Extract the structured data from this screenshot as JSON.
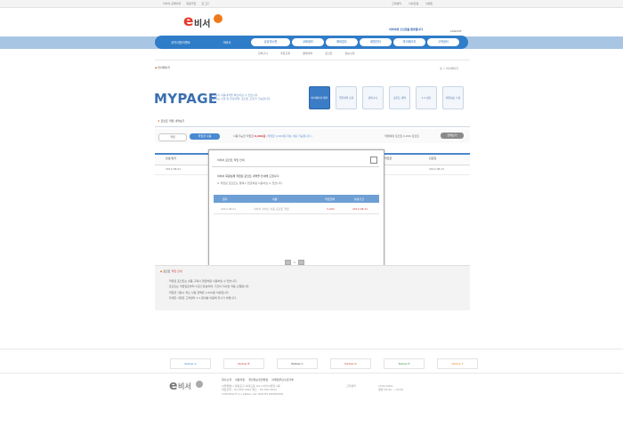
{
  "topbar": {
    "left_links": [
      "이비서 홈페이지",
      "회원가입",
      "로그인"
    ],
    "right_links": [
      "고객센터",
      "사이트맵",
      "이벤트"
    ]
  },
  "brand": {
    "logo_e": "e",
    "logo_text": "비서",
    "slogan": "이비서에 오신것을 환영합니다",
    "logout": "LOGOUT",
    "brand_color": "#2f7cc8",
    "accent_color": "#e8392b"
  },
  "nav": {
    "items": [
      "공지사항/이벤트",
      "이비서",
      "상담게시판",
      "교육정보",
      "해외업무",
      "회원관리",
      "마이페이지",
      "고객센터"
    ]
  },
  "subnav": [
    "장바구니",
    "주문조회",
    "결제내역",
    "포인트",
    "정보수정"
  ],
  "breadcrumb": {
    "left": "마이페이지",
    "right": "홈 > 마이페이지"
  },
  "mypage": {
    "title": "MYPAGE",
    "desc_line1": "고객님의 이용내역을 확인하실 수 있습니다.",
    "desc_line2": "회원정보 수정 및 주문내역, 포인트 조회가 가능합니다."
  },
  "tabs": [
    "마이페이지 메인",
    "주문내역 조회",
    "장바구니",
    "포인트 내역",
    "1:1 상담",
    "회원정보 수정"
  ],
  "section": {
    "title": "포인트 적립 내역보기"
  },
  "points": {
    "btn1": "적립",
    "btn2": "적립금 사용",
    "info_label": "사용가능한 적립금",
    "info_value": "0,000원",
    "info_note": "(적립금 1,000원 이상 사용 가능합니다.)",
    "right_label": "적립예정 포인트 0,000 포인트",
    "right_button": "전체보기"
  },
  "table": {
    "headers": [
      "번호/일자",
      "적립금",
      "만료일"
    ],
    "row": {
      "date": "2012.08.01",
      "end": "2012.08.31"
    }
  },
  "popup": {
    "title": "이비서 포인트 적립 안내",
    "text1": "이비서 회원님께 적립된 포인트 내역을 안내해 드립니다.",
    "text2": "※ 적립된 포인트는 결제시 현금처럼 사용하실 수 있습니다.",
    "headers": [
      "일자",
      "내용",
      "적립금액",
      "유효기간"
    ],
    "row": {
      "date": "2012.08.01",
      "content": "이비서 서비스 이용 포인트 적립",
      "amount": "3,000",
      "valid": "2012.08.31"
    },
    "page_num": "1"
  },
  "notice": {
    "title_prefix": "포인트",
    "title_red": "적립 안내",
    "lines": [
      "· 적립된 포인트는 상품 구매시 현금처럼 사용하실 수 있습니다.",
      "· 포인트는 적립일로부터 1년간 유효하며, 기간이 지나면 자동 소멸됩니다.",
      "· 적립금 사용시 최소 사용 금액은 1,000원 이상입니다.",
      "· 자세한 사항은 고객센터 1:1 문의를 이용해 주시기 바랍니다."
    ]
  },
  "partners": [
    "Partner A",
    "Partner B",
    "Partner C",
    "Partner D",
    "Partner E",
    "Partner F"
  ],
  "footer": {
    "links": [
      "회사소개",
      "이용약관",
      "개인정보취급방침",
      "이메일무단수집거부"
    ],
    "addr1": "서울특별시 영등포구 여의도동 00-0 이비서빌딩 0층",
    "addr2": "대표전화 : 02-000-0000 팩스 : 02-000-0000",
    "addr3": "COPYRIGHT (C) eBiseo ALL RIGHTS RESERVED.",
    "right1": "고객센터",
    "right2": "1544-0000",
    "right3": "평일 09:00 ~ 18:00"
  }
}
